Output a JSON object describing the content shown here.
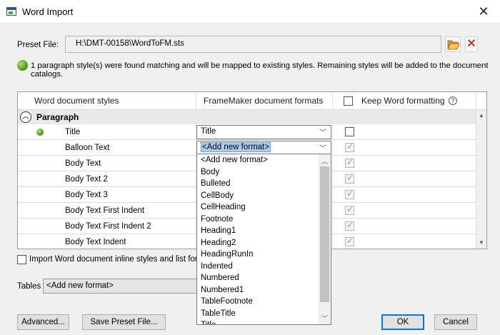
{
  "window": {
    "title": "Word Import",
    "close": "✕"
  },
  "preset": {
    "label": "Preset File:",
    "value": "H:\\DMT-00158\\WordToFM.sts"
  },
  "info": {
    "text": "1 paragraph style(s) were found matching and will be mapped to existing styles. Remaining styles will be added to the document catalogs."
  },
  "grid": {
    "col_word": "Word document styles",
    "col_fm": "FrameMaker document formats",
    "col_keep": "Keep Word formatting",
    "section": "Paragraph",
    "rows": [
      {
        "name": "Title",
        "format": "Title",
        "matched": true
      },
      {
        "name": "Balloon Text",
        "format": "<Add new format>",
        "matched": false
      },
      {
        "name": "Body Text",
        "format": "",
        "matched": false
      },
      {
        "name": "Body Text 2",
        "format": "",
        "matched": false
      },
      {
        "name": "Body Text 3",
        "format": "",
        "matched": false
      },
      {
        "name": "Body Text First Indent",
        "format": "",
        "matched": false
      },
      {
        "name": "Body Text First Indent 2",
        "format": "",
        "matched": false
      },
      {
        "name": "Body Text Indent",
        "format": "",
        "matched": false
      }
    ]
  },
  "dropdown": {
    "items": [
      "<Add new format>",
      "Body",
      "Bulleted",
      "CellBody",
      "CellHeading",
      "Footnote",
      "Heading1",
      "Heading2",
      "HeadingRunIn",
      "Indented",
      "Numbered",
      "Numbered1",
      "TableFootnote",
      "TableTitle",
      "Title"
    ]
  },
  "inline_option": {
    "label": "Import Word document inline styles and list formats"
  },
  "tables": {
    "label": "Tables",
    "value": "<Add new format>"
  },
  "buttons": {
    "advanced": "Advanced...",
    "save_preset": "Save Preset File...",
    "ok": "OK",
    "cancel": "Cancel"
  },
  "colors": {
    "accent": "#0078d7",
    "selection": "#a9cbee",
    "match_green": "#3e8e1c",
    "delete_red": "#c0392b"
  },
  "icons": [
    "app-icon",
    "folder-open-icon",
    "delete-icon",
    "info-dot-icon",
    "help-icon",
    "collapse-icon",
    "chevron-down-icon"
  ]
}
